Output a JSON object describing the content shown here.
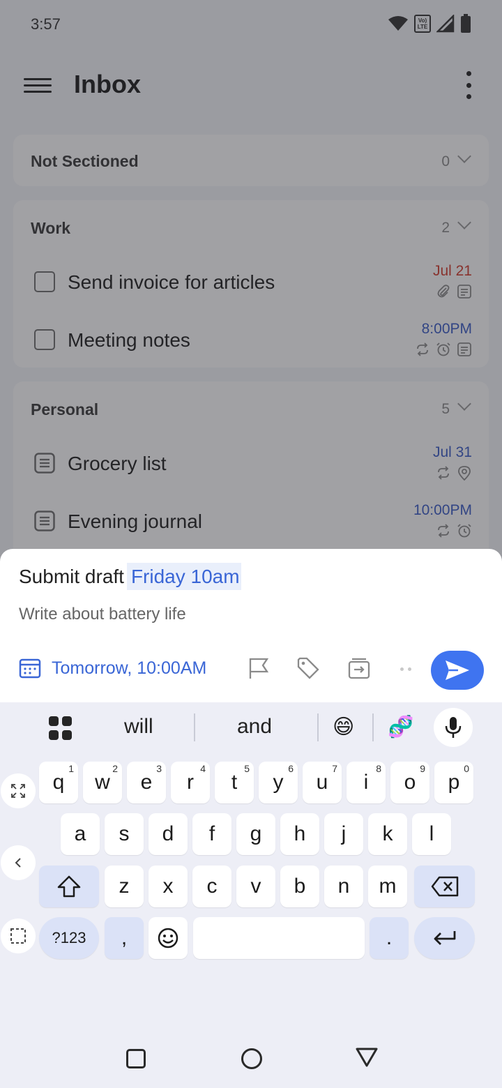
{
  "status_bar": {
    "time": "3:57",
    "network_label": "Vo) LTE"
  },
  "app_bar": {
    "title": "Inbox"
  },
  "sections": [
    {
      "title": "Not Sectioned",
      "count": "0"
    },
    {
      "title": "Work",
      "count": "2"
    },
    {
      "title": "Personal",
      "count": "5"
    }
  ],
  "tasks": {
    "work": [
      {
        "title": "Send invoice for articles",
        "date": "Jul 21",
        "date_color": "#d23b2e"
      },
      {
        "title": "Meeting notes",
        "date": "8:00PM",
        "date_color": "#3a5bc7"
      }
    ],
    "personal": [
      {
        "title": "Grocery list",
        "date": "Jul 31",
        "date_color": "#3a5bc7"
      },
      {
        "title": "Evening journal",
        "date": "10:00PM",
        "date_color": "#3a5bc7"
      }
    ]
  },
  "quick_add": {
    "task_text": "Submit draft",
    "parsed_date": "Friday 10am",
    "description": "Write about battery life",
    "date_button": "Tomorrow, 10:00AM"
  },
  "keyboard": {
    "suggestions": [
      "will",
      "and",
      "😄",
      "🧬"
    ],
    "row1": [
      {
        "k": "q",
        "n": "1"
      },
      {
        "k": "w",
        "n": "2"
      },
      {
        "k": "e",
        "n": "3"
      },
      {
        "k": "r",
        "n": "4"
      },
      {
        "k": "t",
        "n": "5"
      },
      {
        "k": "y",
        "n": "6"
      },
      {
        "k": "u",
        "n": "7"
      },
      {
        "k": "i",
        "n": "8"
      },
      {
        "k": "o",
        "n": "9"
      },
      {
        "k": "p",
        "n": "0"
      }
    ],
    "row2": [
      "a",
      "s",
      "d",
      "f",
      "g",
      "h",
      "j",
      "k",
      "l"
    ],
    "row3": [
      "z",
      "x",
      "c",
      "v",
      "b",
      "n",
      "m"
    ],
    "symbols_key": "?123",
    "comma_key": ",",
    "period_key": "."
  },
  "colors": {
    "accent": "#3f74f0",
    "link_blue": "#3a66d6",
    "overdue_red": "#d23b2e"
  }
}
